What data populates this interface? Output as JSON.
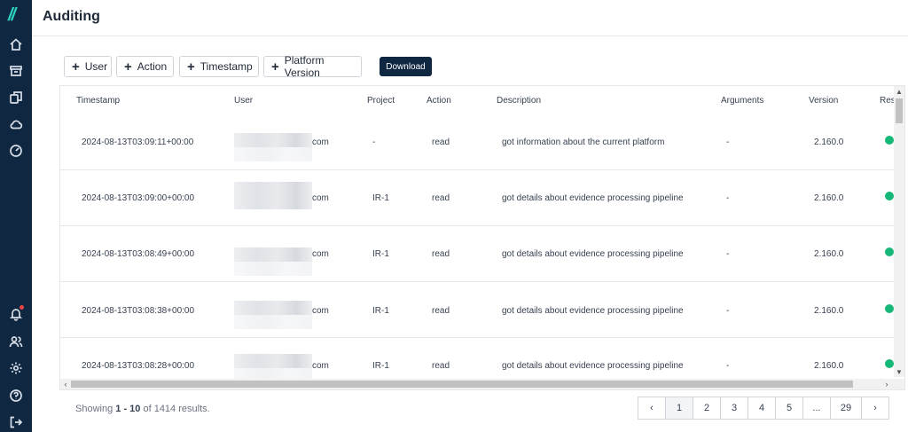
{
  "app": {
    "logo": "//",
    "title": "Auditing"
  },
  "sidebar": {
    "top_icons": [
      "home-icon",
      "archive-icon",
      "copy-icon",
      "cloud-icon",
      "gauge-icon"
    ],
    "bottom_icons": [
      "bell-icon",
      "users-icon",
      "settings-icon",
      "help-icon",
      "logout-icon"
    ]
  },
  "filters": [
    {
      "plus": "+",
      "label": "User"
    },
    {
      "plus": "+",
      "label": "Action"
    },
    {
      "plus": "+",
      "label": "Timestamp"
    },
    {
      "plus": "+",
      "label": "Platform Version"
    }
  ],
  "download_label": "Download",
  "table": {
    "columns": [
      "Timestamp",
      "User",
      "Project",
      "Action",
      "Description",
      "Arguments",
      "Version",
      "Res"
    ],
    "rows": [
      {
        "timestamp": "2024-08-13T03:09:11+00:00",
        "user_suffix": "com",
        "project": "-",
        "action": "read",
        "description": "got information about the current platform",
        "arguments": "-",
        "version": "2.160.0"
      },
      {
        "timestamp": "2024-08-13T03:09:00+00:00",
        "user_suffix": "com",
        "project": "IR-1",
        "action": "read",
        "description": "got details about evidence processing pipeline",
        "arguments": "-",
        "version": "2.160.0"
      },
      {
        "timestamp": "2024-08-13T03:08:49+00:00",
        "user_suffix": "com",
        "project": "IR-1",
        "action": "read",
        "description": "got details about evidence processing pipeline",
        "arguments": "-",
        "version": "2.160.0"
      },
      {
        "timestamp": "2024-08-13T03:08:38+00:00",
        "user_suffix": "com",
        "project": "IR-1",
        "action": "read",
        "description": "got details about evidence processing pipeline",
        "arguments": "-",
        "version": "2.160.0"
      },
      {
        "timestamp": "2024-08-13T03:08:28+00:00",
        "user_suffix": "com",
        "project": "IR-1",
        "action": "read",
        "description": "got details about evidence processing pipeline",
        "arguments": "-",
        "version": "2.160.0"
      }
    ],
    "status_color": "#16b877"
  },
  "footer": {
    "showing_prefix": "Showing",
    "range": "1 - 10",
    "showing_suffix": "of 1414 results."
  },
  "pagination": {
    "prev": "‹",
    "pages": [
      "1",
      "2",
      "3",
      "4",
      "5",
      "...",
      "29"
    ],
    "next": "›"
  }
}
